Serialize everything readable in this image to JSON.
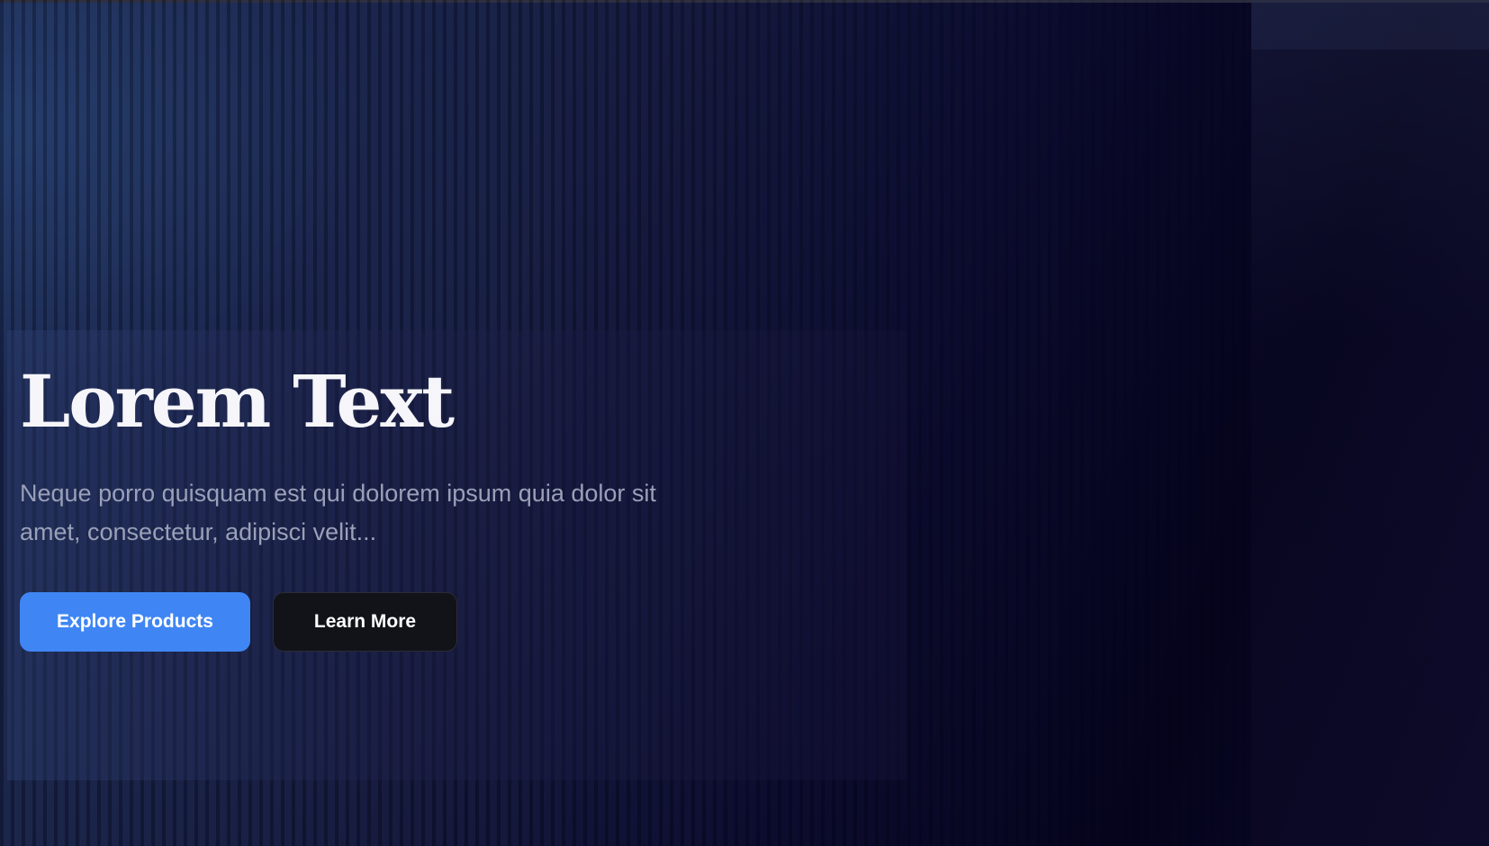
{
  "hero": {
    "title": "Lorem Text",
    "subtitle": "Neque porro quisquam est qui dolorem ipsum quia dolor sit amet, consectetur, adipisci velit...",
    "primary_button": "Explore Products",
    "secondary_button": "Learn More"
  },
  "colors": {
    "primary_button_bg": "#3f86f4",
    "secondary_button_bg": "#121318",
    "title_text": "#f5f5fa",
    "subtitle_text": "#9aa0b8",
    "background_dark": "#0b0b2a"
  }
}
